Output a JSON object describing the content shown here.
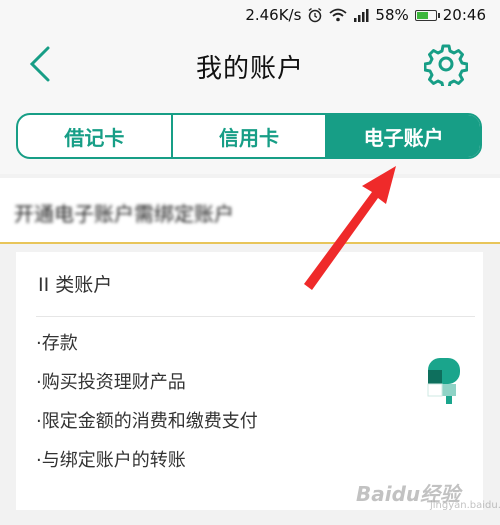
{
  "status_bar": {
    "network_speed": "2.46K/s",
    "battery_percent": "58%",
    "time": "20:46",
    "icons": [
      "alarm-icon",
      "wifi-icon",
      "signal-icon",
      "battery-icon"
    ],
    "battery_level": 0.58
  },
  "header": {
    "title": "我的账户",
    "back_icon": "chevron-left-icon",
    "settings_icon": "gear-icon"
  },
  "tabs": [
    {
      "label": "借记卡",
      "active": false
    },
    {
      "label": "信用卡",
      "active": false
    },
    {
      "label": "电子账户",
      "active": true
    }
  ],
  "notice": {
    "text": "开通电子账户需绑定账户"
  },
  "card": {
    "title": "II 类账户",
    "features": [
      "·存款",
      "·购买投资理财产品",
      "·限定金额的消费和缴费支付",
      "·与绑定账户的转账"
    ]
  },
  "annotation": {
    "color": "#ef2a2a"
  },
  "watermark": {
    "text": "Baidu经验",
    "sub": "jingyan.baidu.com"
  },
  "colors": {
    "accent": "#179e86",
    "divider_gold": "#e8c55a",
    "battery_green": "#3cb63c"
  }
}
